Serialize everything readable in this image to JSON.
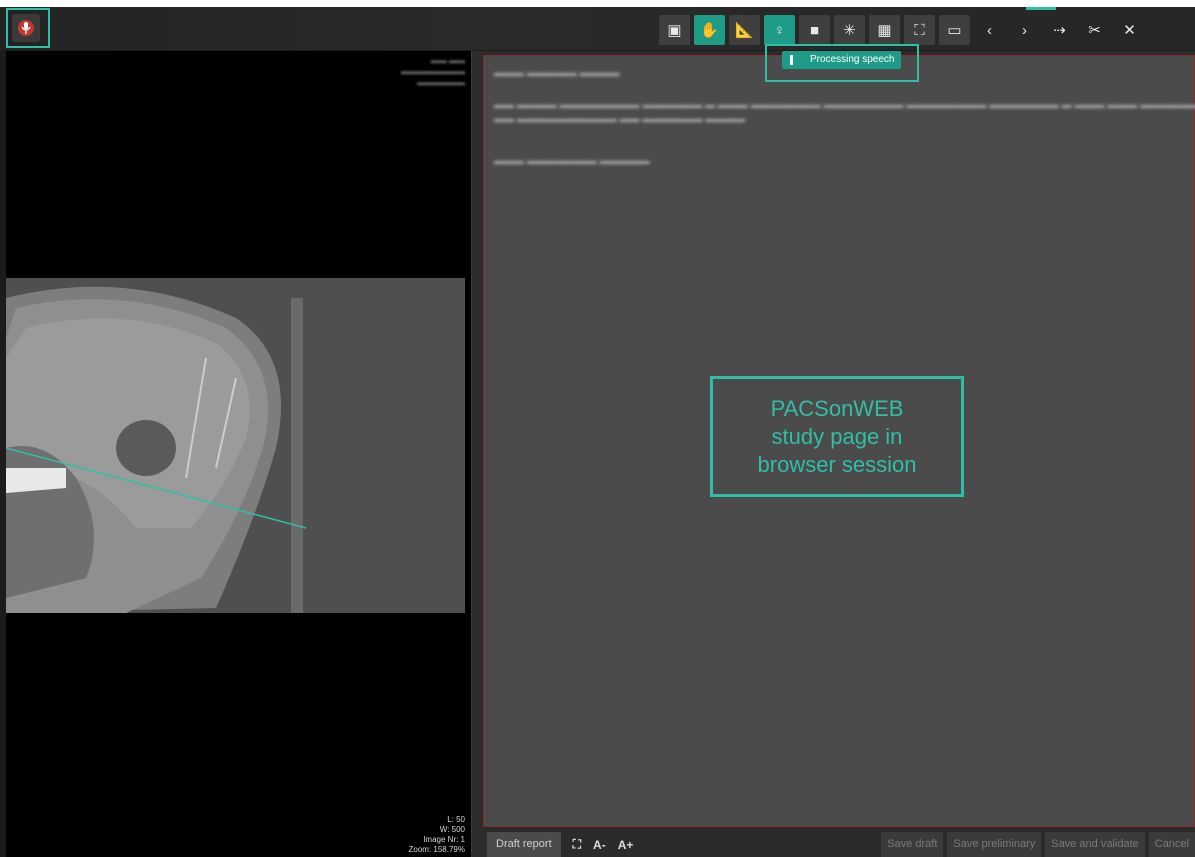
{
  "toolbar": {
    "buttons": [
      {
        "name": "patient-info-icon",
        "glyph": "▣",
        "active": false
      },
      {
        "name": "pan-hand-icon",
        "glyph": "✋",
        "active": true
      },
      {
        "name": "measure-ruler-icon",
        "glyph": "📐",
        "active": false
      },
      {
        "name": "body-figure-icon",
        "glyph": "♀",
        "active": true
      },
      {
        "name": "video-camera-icon",
        "glyph": "■",
        "active": false
      },
      {
        "name": "brightness-icon",
        "glyph": "✳",
        "active": false
      },
      {
        "name": "layout-grid-icon",
        "glyph": "▦",
        "active": false
      },
      {
        "name": "fullscreen-icon",
        "glyph": "⛶",
        "active": false
      },
      {
        "name": "screen-icon",
        "glyph": "▭",
        "active": false
      },
      {
        "name": "previous-icon",
        "glyph": "‹",
        "active": false
      },
      {
        "name": "next-icon",
        "glyph": "›",
        "active": false
      },
      {
        "name": "share-icon",
        "glyph": "⇢",
        "active": false
      },
      {
        "name": "tools-icon",
        "glyph": "✂",
        "active": false
      },
      {
        "name": "close-icon",
        "glyph": "✕",
        "active": false
      }
    ]
  },
  "speech": {
    "status": "Processing speech"
  },
  "viewer": {
    "overlay_bottom_right": [
      "L: 50",
      "W: 500",
      "Image Nr: 1",
      "Zoom: 158.79%"
    ]
  },
  "callout": {
    "lines": [
      "PACSonWEB",
      "study page in",
      "browser session"
    ]
  },
  "report_footer": {
    "draft_tab": "Draft report",
    "font_decrease": "A-",
    "font_increase": "A+",
    "save_draft": "Save draft",
    "save_preliminary": "Save preliminary",
    "save_and_validate": "Save and validate",
    "cancel": "Cancel"
  },
  "colors": {
    "accent": "#2fbfa6",
    "active_button": "#1f9c87",
    "report_border": "#8a2b2b",
    "mic": "#c0392b"
  }
}
